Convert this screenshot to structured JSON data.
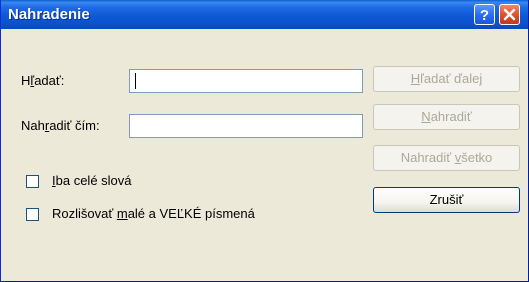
{
  "title": "Nahradenie",
  "titlebar": {
    "help_icon": "?",
    "close_icon": "x"
  },
  "find": {
    "label_pre": "H",
    "label_u": "ľ",
    "label_post": "adať:",
    "value": ""
  },
  "replace": {
    "label_pre": "Nah",
    "label_u": "r",
    "label_post": "adiť čím:",
    "value": ""
  },
  "options": {
    "whole_words": {
      "pre": "",
      "u": "I",
      "post": "ba celé slová",
      "checked": false
    },
    "match_case": {
      "pre": "Rozlišovať ",
      "u": "m",
      "post": "alé a VEĽKÉ písmená",
      "checked": false
    }
  },
  "buttons": {
    "find_next": {
      "pre": "",
      "u": "H",
      "post": "ľadať ďalej",
      "enabled": false
    },
    "replace": {
      "pre": "",
      "u": "N",
      "post": "ahradiť",
      "enabled": false
    },
    "replace_all": {
      "pre": "Nahradiť ",
      "u": "v",
      "post": "šetko",
      "enabled": false
    },
    "cancel": {
      "label": "Zrušiť",
      "enabled": true
    }
  }
}
